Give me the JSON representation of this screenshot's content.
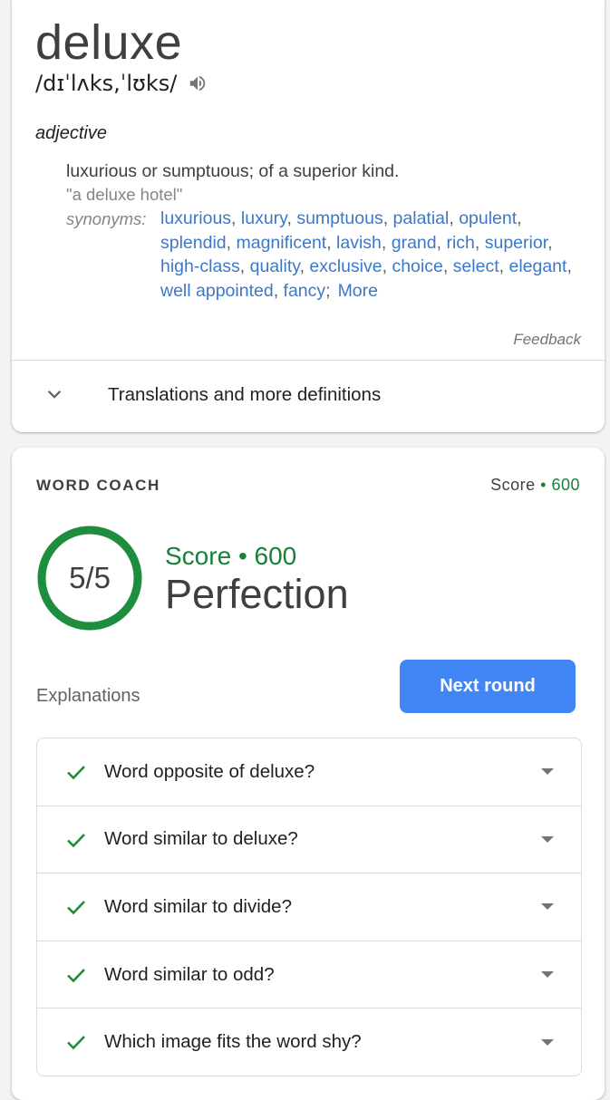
{
  "dictionary": {
    "word": "deluxe",
    "pronunciation": "/dɪˈlʌks,ˈlʊks/",
    "speaker_icon": "speaker-icon",
    "part_of_speech": "adjective",
    "definition": "luxurious or sumptuous; of a superior kind.",
    "example": "\"a deluxe hotel\"",
    "synonyms_label": "synonyms:",
    "synonyms": [
      "luxurious",
      "luxury",
      "sumptuous",
      "palatial",
      "opulent",
      "splendid",
      "magnificent",
      "lavish",
      "grand",
      "rich",
      "superior",
      "high-class",
      "quality",
      "exclusive",
      "choice",
      "select",
      "elegant",
      "well appointed",
      "fancy"
    ],
    "more_label": "More",
    "feedback_label": "Feedback",
    "translations_label": "Translations and more definitions"
  },
  "word_coach": {
    "title": "WORD COACH",
    "score_label": "Score",
    "score_separator": "•",
    "score_value": "600",
    "result": "5/5",
    "result_fraction": 1.0,
    "result_title": "Perfection",
    "explanations_label": "Explanations",
    "next_button_label": "Next round",
    "questions": [
      "Word opposite of deluxe?",
      "Word similar to deluxe?",
      "Word similar to divide?",
      "Word similar to odd?",
      "Which image fits the word shy?"
    ]
  },
  "colors": {
    "accent_green": "#188038",
    "ring_green": "#1e8e3e",
    "button_blue": "#4285f4",
    "link_blue": "#3c78c8"
  }
}
